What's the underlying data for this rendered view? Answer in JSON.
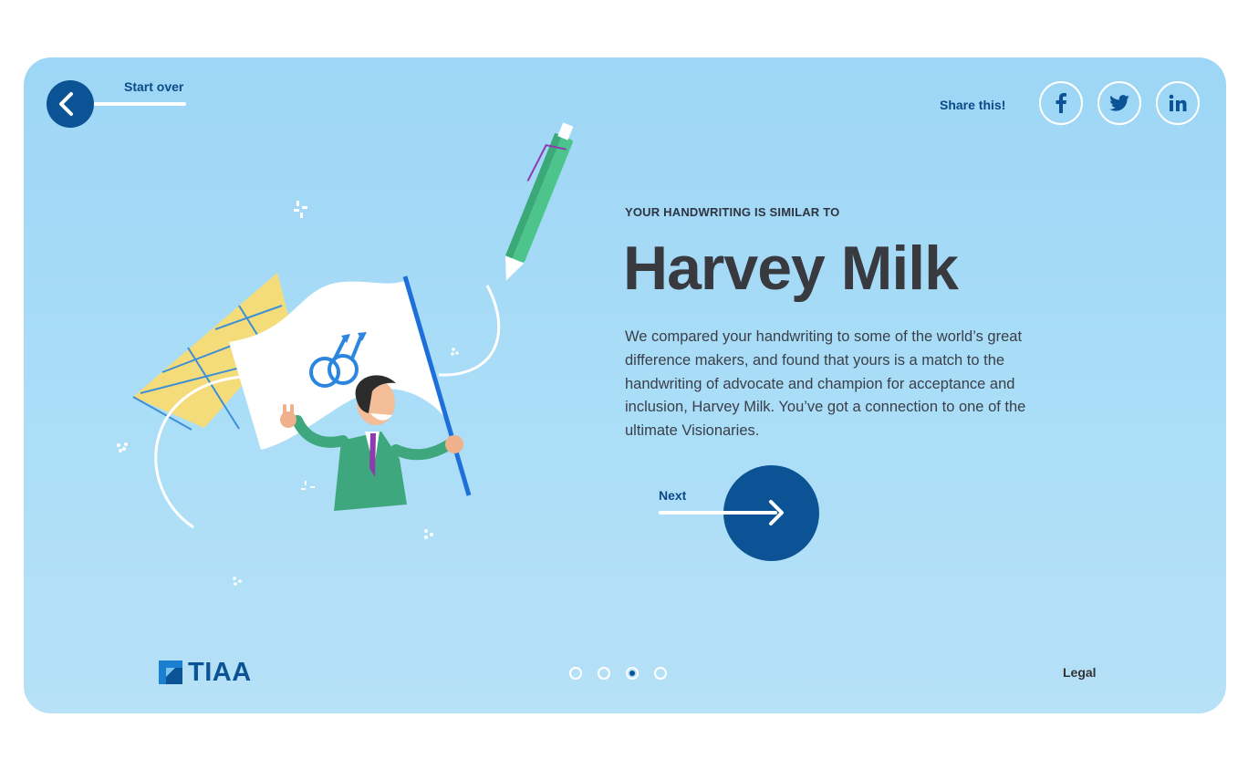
{
  "nav": {
    "start_over_label": "Start over",
    "share_label": "Share this!"
  },
  "social": [
    {
      "name": "facebook-icon",
      "glyph": "f"
    },
    {
      "name": "twitter-icon",
      "glyph": "twitter bird"
    },
    {
      "name": "linkedin-icon",
      "glyph": "in"
    }
  ],
  "result": {
    "kicker": "YOUR HANDWRITING IS SIMILAR TO",
    "name": "Harvey Milk",
    "description": "We compared your handwriting to some of the world’s great difference makers, and found that yours is a match to the handwriting of advocate and champion for acceptance and inclusion, Harvey Milk. You’ve got a connection to one of the ultimate Visionaries."
  },
  "next": {
    "label": "Next"
  },
  "footer": {
    "logo_text": "TIAA",
    "legal_label": "Legal",
    "pagination": {
      "total": 4,
      "active": 3
    }
  },
  "colors": {
    "background": "#9dd6f6",
    "accent": "#0b5394",
    "title": "#383a40"
  }
}
